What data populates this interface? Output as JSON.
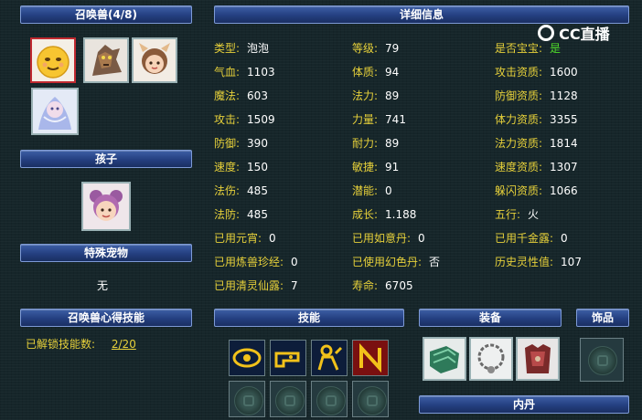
{
  "panels": {
    "pets_header": "召唤兽(4/8)",
    "detail_header": "详细信息",
    "child_header": "孩子",
    "special_header": "特殊宠物",
    "special_value": "无",
    "heart_skill_header": "召唤兽心得技能",
    "skills_header": "技能",
    "equip_header": "装备",
    "accessory_header": "饰品",
    "core_header": "内丹"
  },
  "heart_skill": {
    "label": "已解锁技能数:",
    "value": "2/20"
  },
  "watermark": {
    "text": "CC直播"
  },
  "stats": {
    "col1": [
      {
        "label": "类型:",
        "value": "泡泡"
      },
      {
        "label": "气血:",
        "value": "1103"
      },
      {
        "label": "魔法:",
        "value": "603"
      },
      {
        "label": "攻击:",
        "value": "1509"
      },
      {
        "label": "防御:",
        "value": "390"
      },
      {
        "label": "速度:",
        "value": "150"
      },
      {
        "label": "法伤:",
        "value": "485"
      },
      {
        "label": "法防:",
        "value": "485"
      }
    ],
    "col2": [
      {
        "label": "等级:",
        "value": "79"
      },
      {
        "label": "体质:",
        "value": "94"
      },
      {
        "label": "法力:",
        "value": "89"
      },
      {
        "label": "力量:",
        "value": "741"
      },
      {
        "label": "耐力:",
        "value": "89"
      },
      {
        "label": "敏捷:",
        "value": "91"
      },
      {
        "label": "潜能:",
        "value": "0"
      },
      {
        "label": "成长:",
        "value": "1.188"
      }
    ],
    "col3": [
      {
        "label": "是否宝宝:",
        "value": "是"
      },
      {
        "label": "攻击资质:",
        "value": "1600"
      },
      {
        "label": "防御资质:",
        "value": "1128"
      },
      {
        "label": "体力资质:",
        "value": "3355"
      },
      {
        "label": "法力资质:",
        "value": "1814"
      },
      {
        "label": "速度资质:",
        "value": "1307"
      },
      {
        "label": "躲闪资质:",
        "value": "1066"
      },
      {
        "label": "五行:",
        "value": "火"
      }
    ],
    "extra": [
      {
        "label": "已用元宵:",
        "value": "0"
      },
      {
        "label": "已用如意丹:",
        "value": "0"
      },
      {
        "label": "已用千金露:",
        "value": "0"
      },
      {
        "label": "已用炼兽珍经:",
        "value": "0"
      },
      {
        "label": "已使用幻色丹:",
        "value": "否"
      },
      {
        "label": "历史灵性值:",
        "value": "107"
      },
      {
        "label": "已用清灵仙露:",
        "value": "7"
      },
      {
        "label": "寿命:",
        "value": "6705"
      }
    ]
  },
  "colors": {
    "label": "#e6d03a",
    "value": "#ffffff",
    "is_baby": "#4fdc2a"
  }
}
